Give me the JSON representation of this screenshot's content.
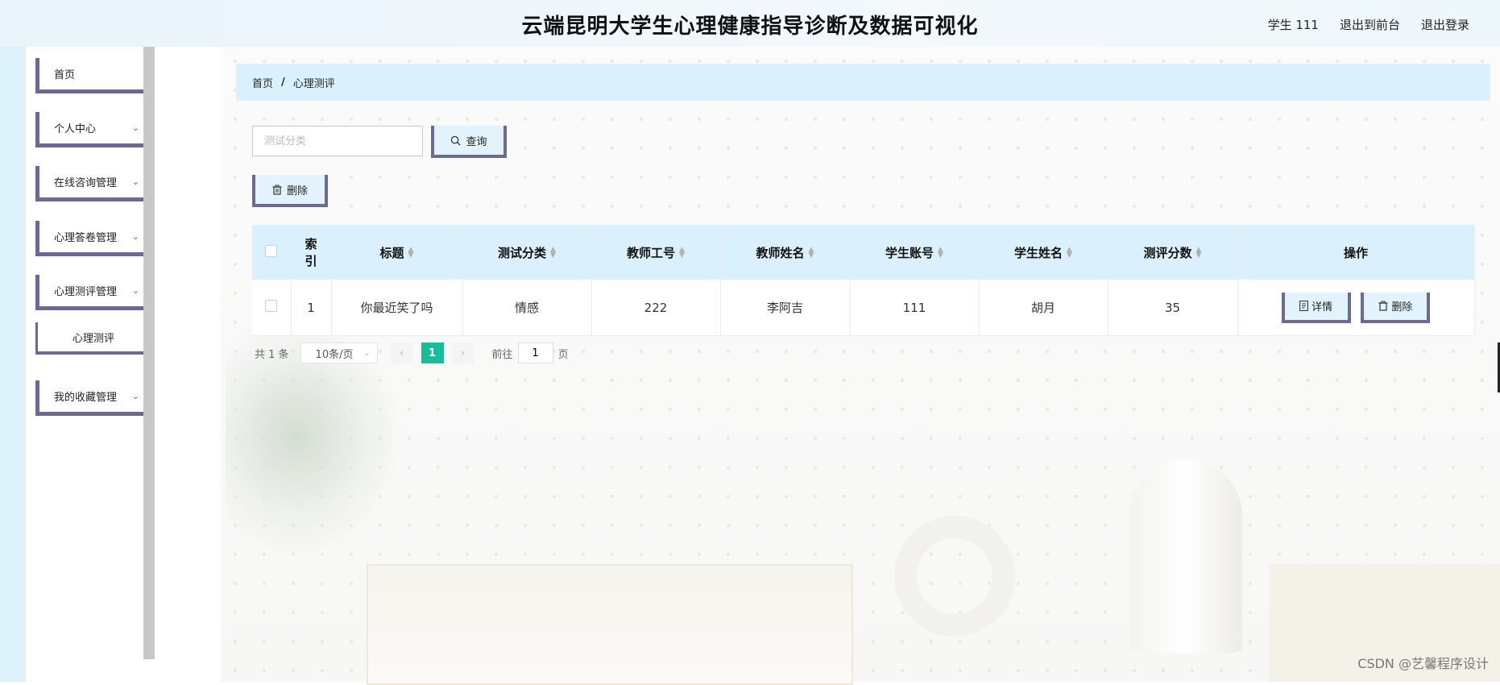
{
  "header": {
    "title": "云端昆明大学生心理健康指导诊断及数据可视化",
    "user": "学生 111",
    "front_link": "退出到前台",
    "logout_link": "退出登录"
  },
  "sidebar": {
    "items": [
      {
        "label": "首页"
      },
      {
        "label": "个人中心"
      },
      {
        "label": "在线咨询管理"
      },
      {
        "label": "心理答卷管理"
      },
      {
        "label": "心理测评管理"
      },
      {
        "label": "我的收藏管理"
      }
    ],
    "submenu": {
      "label": "心理测评"
    }
  },
  "breadcrumb": {
    "home": "首页",
    "separator": "/",
    "current": "心理测评"
  },
  "search": {
    "placeholder": "测试分类",
    "button_label": "查询"
  },
  "toolbar": {
    "delete_label": "删除"
  },
  "table": {
    "headers": {
      "index_1": "索",
      "index_2": "引",
      "title": "标题",
      "category": "测试分类",
      "teacher_id": "教师工号",
      "teacher_name": "教师姓名",
      "student_account": "学生账号",
      "student_name": "学生姓名",
      "score": "测评分数",
      "actions": "操作"
    },
    "rows": [
      {
        "index": "1",
        "title": "你最近笑了吗",
        "category": "情感",
        "teacher_id": "222",
        "teacher_name": "李阿吉",
        "student_account": "111",
        "student_name": "胡月",
        "score": "35",
        "detail_label": "详情",
        "delete_label": "删除"
      }
    ]
  },
  "pagination": {
    "total": "共 1 条",
    "page_size": "10条/页",
    "current_page": "1",
    "goto_prefix": "前往",
    "goto_value": "1",
    "goto_suffix": "页"
  },
  "watermark": "CSDN @艺馨程序设计",
  "colors": {
    "accent_border": "#6d6a92",
    "light_blue": "#daf0fc",
    "active_page": "#1abc9c"
  }
}
